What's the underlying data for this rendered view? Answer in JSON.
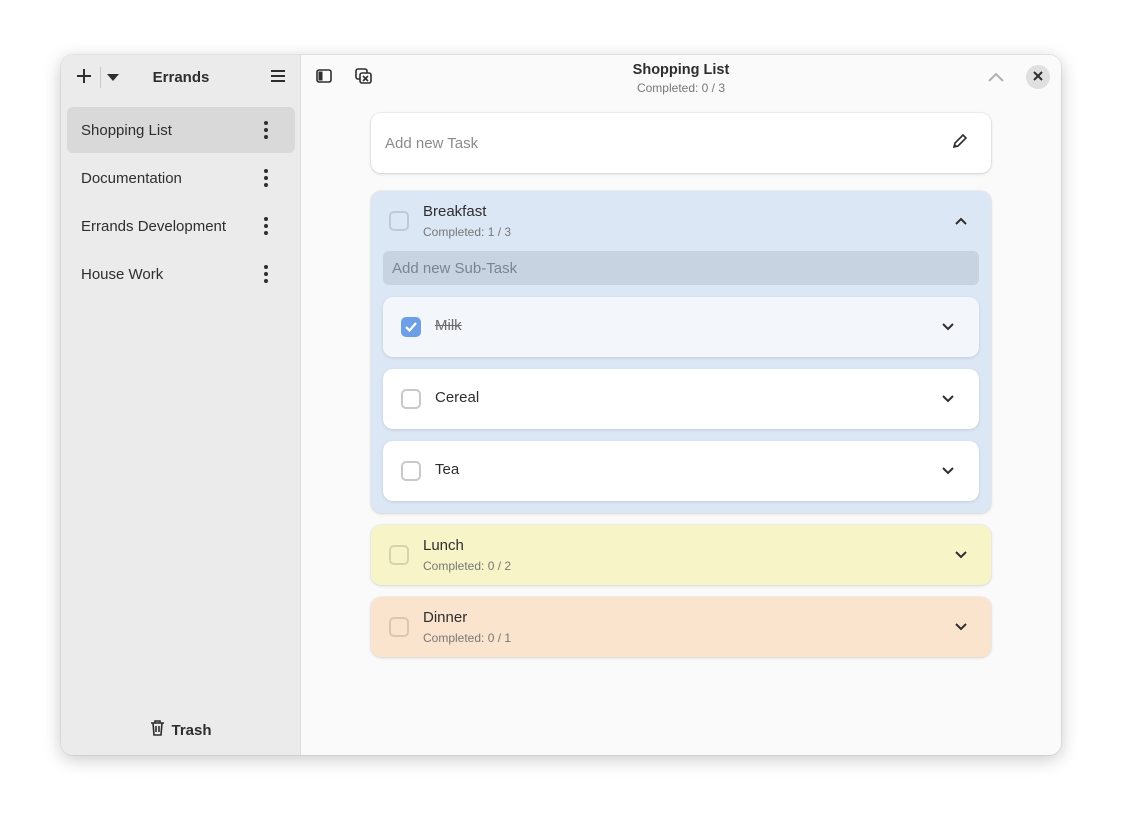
{
  "sidebar": {
    "title": "Errands",
    "lists": [
      {
        "label": "Shopping List",
        "selected": true
      },
      {
        "label": "Documentation",
        "selected": false
      },
      {
        "label": "Errands Development",
        "selected": false
      },
      {
        "label": "House Work",
        "selected": false
      }
    ],
    "trash_label": "Trash"
  },
  "header": {
    "title": "Shopping List",
    "subtitle": "Completed: 0 / 3"
  },
  "add_task": {
    "placeholder": "Add new Task"
  },
  "tasks": [
    {
      "title": "Breakfast",
      "completed": "Completed: 1 / 3",
      "color": "#dce7f5",
      "expanded": true,
      "subtask_placeholder": "Add new Sub-Task",
      "subtasks": [
        {
          "title": "Milk",
          "done": true
        },
        {
          "title": "Cereal",
          "done": false
        },
        {
          "title": "Tea",
          "done": false
        }
      ]
    },
    {
      "title": "Lunch",
      "completed": "Completed: 0 / 2",
      "color": "#f7f4c8",
      "expanded": false
    },
    {
      "title": "Dinner",
      "completed": "Completed: 0 / 1",
      "color": "#fbe4ce",
      "expanded": false
    }
  ],
  "colors": {
    "accent": "#6c9fe6",
    "sidebar_bg": "#ebebeb",
    "selected_bg": "#d9d9d9"
  }
}
